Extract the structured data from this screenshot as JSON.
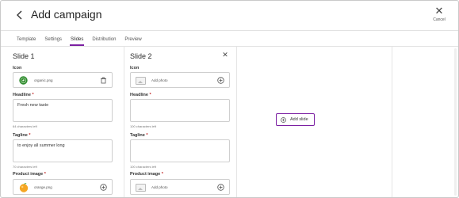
{
  "header": {
    "title": "Add campaign",
    "cancel_label": "Cancel"
  },
  "tabs": [
    {
      "label": "Template",
      "active": false
    },
    {
      "label": "Settings",
      "active": false
    },
    {
      "label": "Slides",
      "active": true
    },
    {
      "label": "Distribution",
      "active": false
    },
    {
      "label": "Preview",
      "active": false
    }
  ],
  "slides": [
    {
      "title": "Slide 1",
      "icon_label": "Icon",
      "icon_file": "organic.png",
      "headline_label": "Headline",
      "headline_value": "Fresh new taste",
      "headline_hint": "64 characters left",
      "tagline_label": "Tagline",
      "tagline_value": "to enjoy all summer long",
      "tagline_hint": "70 characters left",
      "product_label": "Product image",
      "product_file": "orange.png"
    },
    {
      "title": "Slide 2",
      "icon_label": "Icon",
      "icon_placeholder": "Add photo",
      "headline_label": "Headline",
      "headline_value": "",
      "headline_hint": "100 characters left",
      "tagline_label": "Tagline",
      "tagline_value": "",
      "tagline_hint": "100 characters left",
      "product_label": "Product image",
      "product_placeholder": "Add photo"
    }
  ],
  "required_mark": "*",
  "add_slide_label": "Add slide",
  "colors": {
    "accent": "#7b1fa2",
    "required": "#c02020",
    "organic_green": "#2e8b2e",
    "orange": "#f5a623"
  },
  "icons": [
    "back-arrow-icon",
    "close-icon",
    "trash-icon",
    "add-circle-icon",
    "photo-placeholder-icon"
  ]
}
